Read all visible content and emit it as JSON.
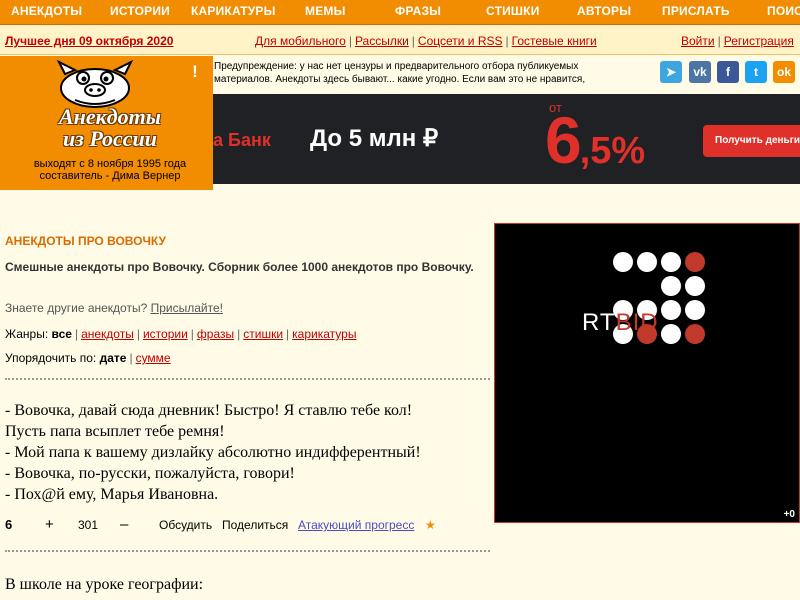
{
  "nav": {
    "items": [
      "АНЕКДОТЫ",
      "ИСТОРИИ",
      "КАРИКАТУРЫ",
      "МЕМЫ",
      "ФРАЗЫ",
      "СТИШКИ",
      "АВТОРЫ",
      "ПРИСЛАТЬ",
      "ПОИС"
    ]
  },
  "strip": {
    "best": "Лучшее дня 09 октября 2020",
    "links": [
      "Для мобильного",
      "Рассылки",
      "Соцсети и RSS",
      "Гостевые книги"
    ],
    "auth": [
      "Войти",
      "Регистрация"
    ]
  },
  "logo": {
    "title_line1": "Анекдоты",
    "title_line2": "из России",
    "subtitle_line1": "выходят с 8 ноября 1995 года",
    "subtitle_line2": "составитель - Дима Вернер"
  },
  "warning": {
    "icon": "!",
    "text": "Предупреждение: у нас нет цензуры и предварительного отбора публикуемых материалов. Анекдоты здесь бывают... какие угодно. Если вам это не нравится,"
  },
  "social": [
    {
      "icon": "telegram-icon",
      "glyph": "➤",
      "color": "#3fa6dd"
    },
    {
      "icon": "vk-icon",
      "glyph": "vk",
      "color": "#4c75a3"
    },
    {
      "icon": "facebook-icon",
      "glyph": "f",
      "color": "#3b5998"
    },
    {
      "icon": "twitter-icon",
      "glyph": "t",
      "color": "#1da1f2"
    },
    {
      "icon": "odnoklassniki-icon",
      "glyph": "ok",
      "color": "#f28c00"
    }
  ],
  "banner": {
    "bank": "а Банк",
    "amount": "До 5 млн ₽",
    "from": "от",
    "rate_big": "6",
    "rate_small": ",5%",
    "cta": "Получить деньги"
  },
  "section": {
    "title": "АНЕКДОТЫ ПРО ВОВОЧКУ",
    "description": "Смешные анекдоты про Вовочку. Сборник более 1000 анекдотов про Вовочку.",
    "other_prefix": "Знаете другие анекдоты?",
    "other_link": "Присылайте!",
    "genres_label": "Жанры:",
    "genres_current": "все",
    "genres": [
      "анекдоты",
      "истории",
      "фразы",
      "стишки",
      "карикатуры"
    ],
    "order_label": "Упорядочить по:",
    "order_current": "дате",
    "order_alt": "сумме"
  },
  "joke": {
    "lines": [
      "- Вовочка, давай сюда дневник! Быстро! Я ставлю тебе кол!",
      "Пусть папа всыплет тебе ремня!",
      "- Мой папа к вашему дизлайку абсолютно индифферентный!",
      "- Вовочка, по-русски, пожалуйста, говори!",
      "- Пох@й ему, Марья Ивановна."
    ],
    "score": "6",
    "plus": "+",
    "votes": "301",
    "minus": "–",
    "discuss": "Обсудить",
    "share": "Поделиться",
    "tag": "Атакующий прогресс",
    "star": "★"
  },
  "joke2": {
    "first_line": "В школе на уроке географии:"
  },
  "ad": {
    "logo_rt": "RT",
    "logo_bid": "BID",
    "counter": "+0",
    "accent": "#c0392b"
  }
}
